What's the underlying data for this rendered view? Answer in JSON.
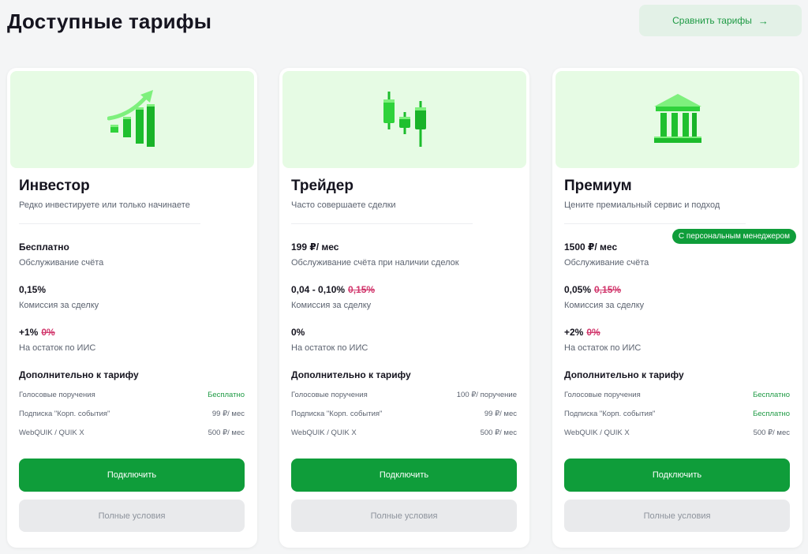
{
  "page": {
    "title": "Доступные тарифы",
    "compare_label": "Сравнить тарифы",
    "compare_arrow": "→"
  },
  "colors": {
    "accent": "#0f9d3a",
    "hero_bg": "#e6fbe4",
    "old_price": "#d1356b"
  },
  "plans": [
    {
      "icon": "growth-chart-icon",
      "name": "Инвестор",
      "description": "Редко инвестируете или только начинаете",
      "service_price": "Бесплатно",
      "service_label": "Обслуживание счёта",
      "commission": "0,15%",
      "commission_old": "",
      "commission_label": "Комиссия за сделку",
      "iis_rate": "+1%",
      "iis_rate_old": "0%",
      "iis_label": "На остаток по ИИС",
      "extras_title": "Дополнительно к тарифу",
      "extras": [
        {
          "name": "Голосовые поручения",
          "price": "Бесплатно",
          "green": true
        },
        {
          "name": "Подписка \"Корп. события\"",
          "price": "99 ₽/ мес",
          "green": false
        },
        {
          "name": "WebQUIK / QUIK X",
          "price": "500 ₽/ мес",
          "green": false
        }
      ],
      "connect_label": "Подключить",
      "terms_label": "Полные условия"
    },
    {
      "icon": "candlestick-icon",
      "name": "Трейдер",
      "description": "Часто совершаете сделки",
      "service_price": "199 ₽/ мес",
      "service_label": "Обслуживание счёта при наличии сделок",
      "commission": "0,04 - 0,10%",
      "commission_old": "0,15%",
      "commission_label": "Комиссия за сделку",
      "iis_rate": "0%",
      "iis_rate_old": "",
      "iis_label": "На остаток по ИИС",
      "extras_title": "Дополнительно к тарифу",
      "extras": [
        {
          "name": "Голосовые поручения",
          "price": "100 ₽/ поручение",
          "green": false
        },
        {
          "name": "Подписка \"Корп. события\"",
          "price": "99 ₽/ мес",
          "green": false
        },
        {
          "name": "WebQUIK / QUIK X",
          "price": "500 ₽/ мес",
          "green": false
        }
      ],
      "connect_label": "Подключить",
      "terms_label": "Полные условия"
    },
    {
      "icon": "bank-building-icon",
      "badge": "С персональным менеджером",
      "name": "Премиум",
      "description": "Цените премиальный сервис и подход",
      "service_price": "1500 ₽/ мес",
      "service_label": "Обслуживание счёта",
      "commission": "0,05%",
      "commission_old": "0,15%",
      "commission_label": "Комиссия за сделку",
      "iis_rate": "+2%",
      "iis_rate_old": "0%",
      "iis_label": "На остаток по ИИС",
      "extras_title": "Дополнительно к тарифу",
      "extras": [
        {
          "name": "Голосовые поручения",
          "price": "Бесплатно",
          "green": true
        },
        {
          "name": "Подписка \"Корп. события\"",
          "price": "Бесплатно",
          "green": true
        },
        {
          "name": "WebQUIK / QUIK X",
          "price": "500 ₽/ мес",
          "green": false
        }
      ],
      "connect_label": "Подключить",
      "terms_label": "Полные условия"
    }
  ]
}
